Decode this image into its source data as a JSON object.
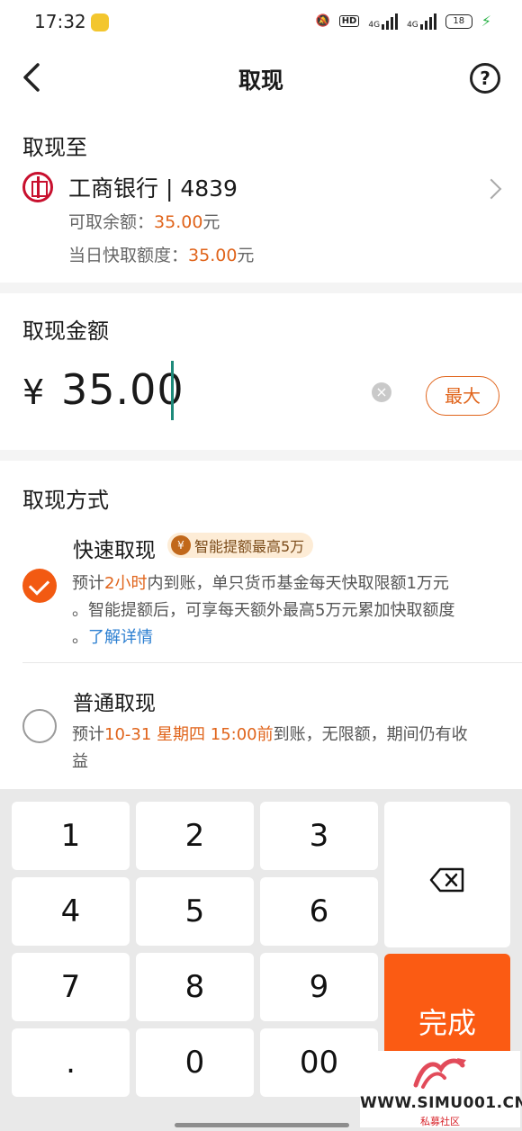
{
  "status_bar": {
    "time": "17:32",
    "hd": "HD",
    "net1": "4G",
    "net2": "4G",
    "battery": "18"
  },
  "header": {
    "title": "取现"
  },
  "destination": {
    "label": "取现至",
    "bank_name": "工商银行 | 4839",
    "available_label": "可取余额：",
    "available_value": "35.00",
    "quick_limit_label": "当日快取额度：",
    "quick_limit_value": "35.00",
    "unit": "元"
  },
  "amount": {
    "label": "取现金额",
    "currency": "¥",
    "value": "35.00",
    "max_label": "最大"
  },
  "methods": {
    "label": "取现方式",
    "fast": {
      "title": "快速取现",
      "badge": "智能提额最高5万",
      "selected": true,
      "desc1_pre": "预计",
      "desc1_hl": "2小时",
      "desc1_post": "内到账，单只货币基金每天快取限额1万元",
      "desc2": "。智能提额后，可享每天额外最高5万元累加快取额度",
      "desc3_pre": "。",
      "link": "了解详情"
    },
    "normal": {
      "title": "普通取现",
      "selected": false,
      "desc1_pre": "预计",
      "desc1_hl": "10-31 星期四 15:00前",
      "desc1_post": "到账，无限额，期间仍有收",
      "desc2": "益"
    }
  },
  "keypad": {
    "keys": [
      "1",
      "2",
      "3",
      "4",
      "5",
      "6",
      "7",
      "8",
      "9",
      ".",
      "0",
      "00"
    ],
    "done_label": "完成"
  },
  "watermark": {
    "text": "WWW.SIMU001.CN",
    "sub": "私募社区"
  },
  "colors": {
    "accent": "#f25a12",
    "highlight": "#e0641b",
    "link": "#2c7fd1",
    "bank_red": "#c8102e"
  }
}
